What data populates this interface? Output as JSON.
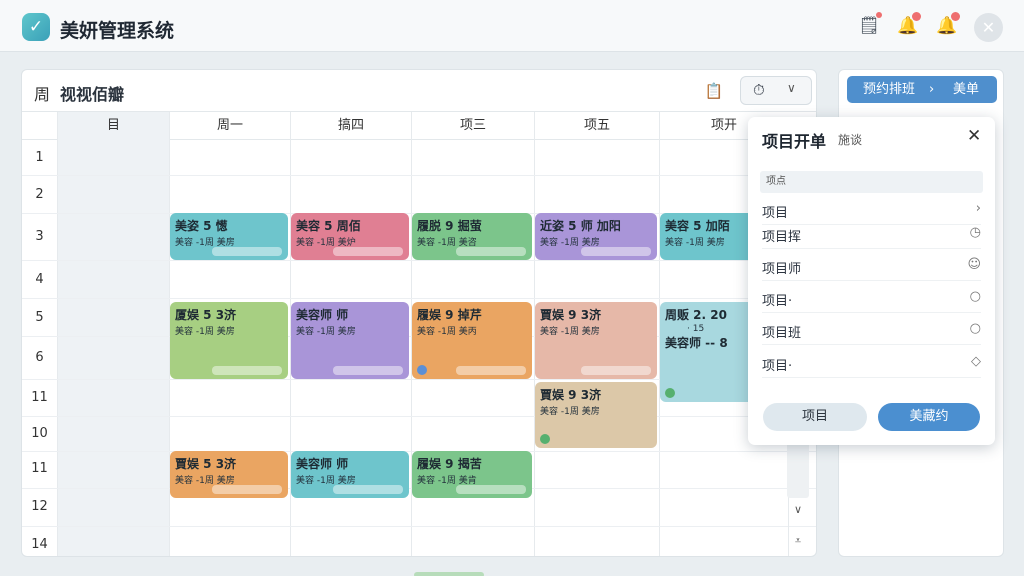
{
  "header": {
    "logo_glyph": "✓",
    "app_title": "美妍管理系统",
    "icons": [
      "clipboard-bell-icon",
      "bell-icon",
      "bell-icon",
      "close-icon"
    ]
  },
  "calendar": {
    "week_label": "周",
    "title": "视视佰瓣",
    "columns": [
      "目",
      "周一",
      "搞四",
      "项三",
      "项五",
      "项开"
    ],
    "rows": [
      "1",
      "2",
      "3",
      "4",
      "5",
      "6",
      "11",
      "10",
      "11",
      "12",
      "14"
    ]
  },
  "events": [
    {
      "title": "美姿 5  憽",
      "sub": "美容 -1周  美房",
      "color": "teal"
    },
    {
      "title": "美容 5  周佰",
      "sub": "美容 -1周  美炉",
      "color": "pink"
    },
    {
      "title": "履脱 9  掘萤",
      "sub": "美容 -1周  美咨",
      "color": "green"
    },
    {
      "title": "近姿 5  师  加阳",
      "sub": "美容 -1周  美房",
      "color": "purple"
    },
    {
      "title": "美容 5  加陌",
      "sub": "美容 -1周  美房",
      "color": "teal"
    },
    {
      "title": "厦娱 5  3济",
      "sub": "美容 -1周  美房",
      "color": "lime"
    },
    {
      "title": "美容师  师",
      "sub": "美容 -1周  美房",
      "color": "purple"
    },
    {
      "title": "履娱 9  掉芹",
      "sub": "美容 -1周  美丙",
      "color": "orange"
    },
    {
      "title": "賈娱 9  3济",
      "sub": "美容 -1周  美房",
      "color": "peach"
    },
    {
      "title": "周贩 2. 20",
      "sub": "美容师 -- 8",
      "extra": "· 15",
      "color": "sky"
    },
    {
      "title": "賈娱 9  3济",
      "sub": "美容 -1周  美房",
      "color": "beige"
    },
    {
      "title": "賈娱 5  3济",
      "sub": "美容 -1周  美房",
      "color": "orange"
    },
    {
      "title": "美容师  师",
      "sub": "美容 -1周  美房",
      "color": "teal"
    },
    {
      "title": "履娱 9  揭苦",
      "sub": "美容 -1周  美肯",
      "color": "green"
    }
  ],
  "right_panel": {
    "button_label": "预约排班",
    "button_sep": "›",
    "button_sub": "美单"
  },
  "popup": {
    "title": "项目开单",
    "subtitle": "施谈",
    "search_placeholder": "项点",
    "rows": [
      {
        "label": "项目",
        "icon": "›"
      },
      {
        "label": "项目挥",
        "icon": "◷"
      },
      {
        "label": "项目师",
        "icon": "☺"
      },
      {
        "label": "项目·",
        "icon": "○"
      },
      {
        "label": "项目班",
        "icon": "○"
      },
      {
        "label": "项目·",
        "icon": "◇"
      }
    ],
    "cancel_label": "项目",
    "confirm_label": "美藏约"
  },
  "colors": {
    "teal": "#6ec5cc",
    "pink": "#e07f93",
    "green": "#7cc58b",
    "purple": "#a995d8",
    "lime": "#a7cf82",
    "orange": "#eaa562",
    "primary": "#4f8fcd"
  }
}
